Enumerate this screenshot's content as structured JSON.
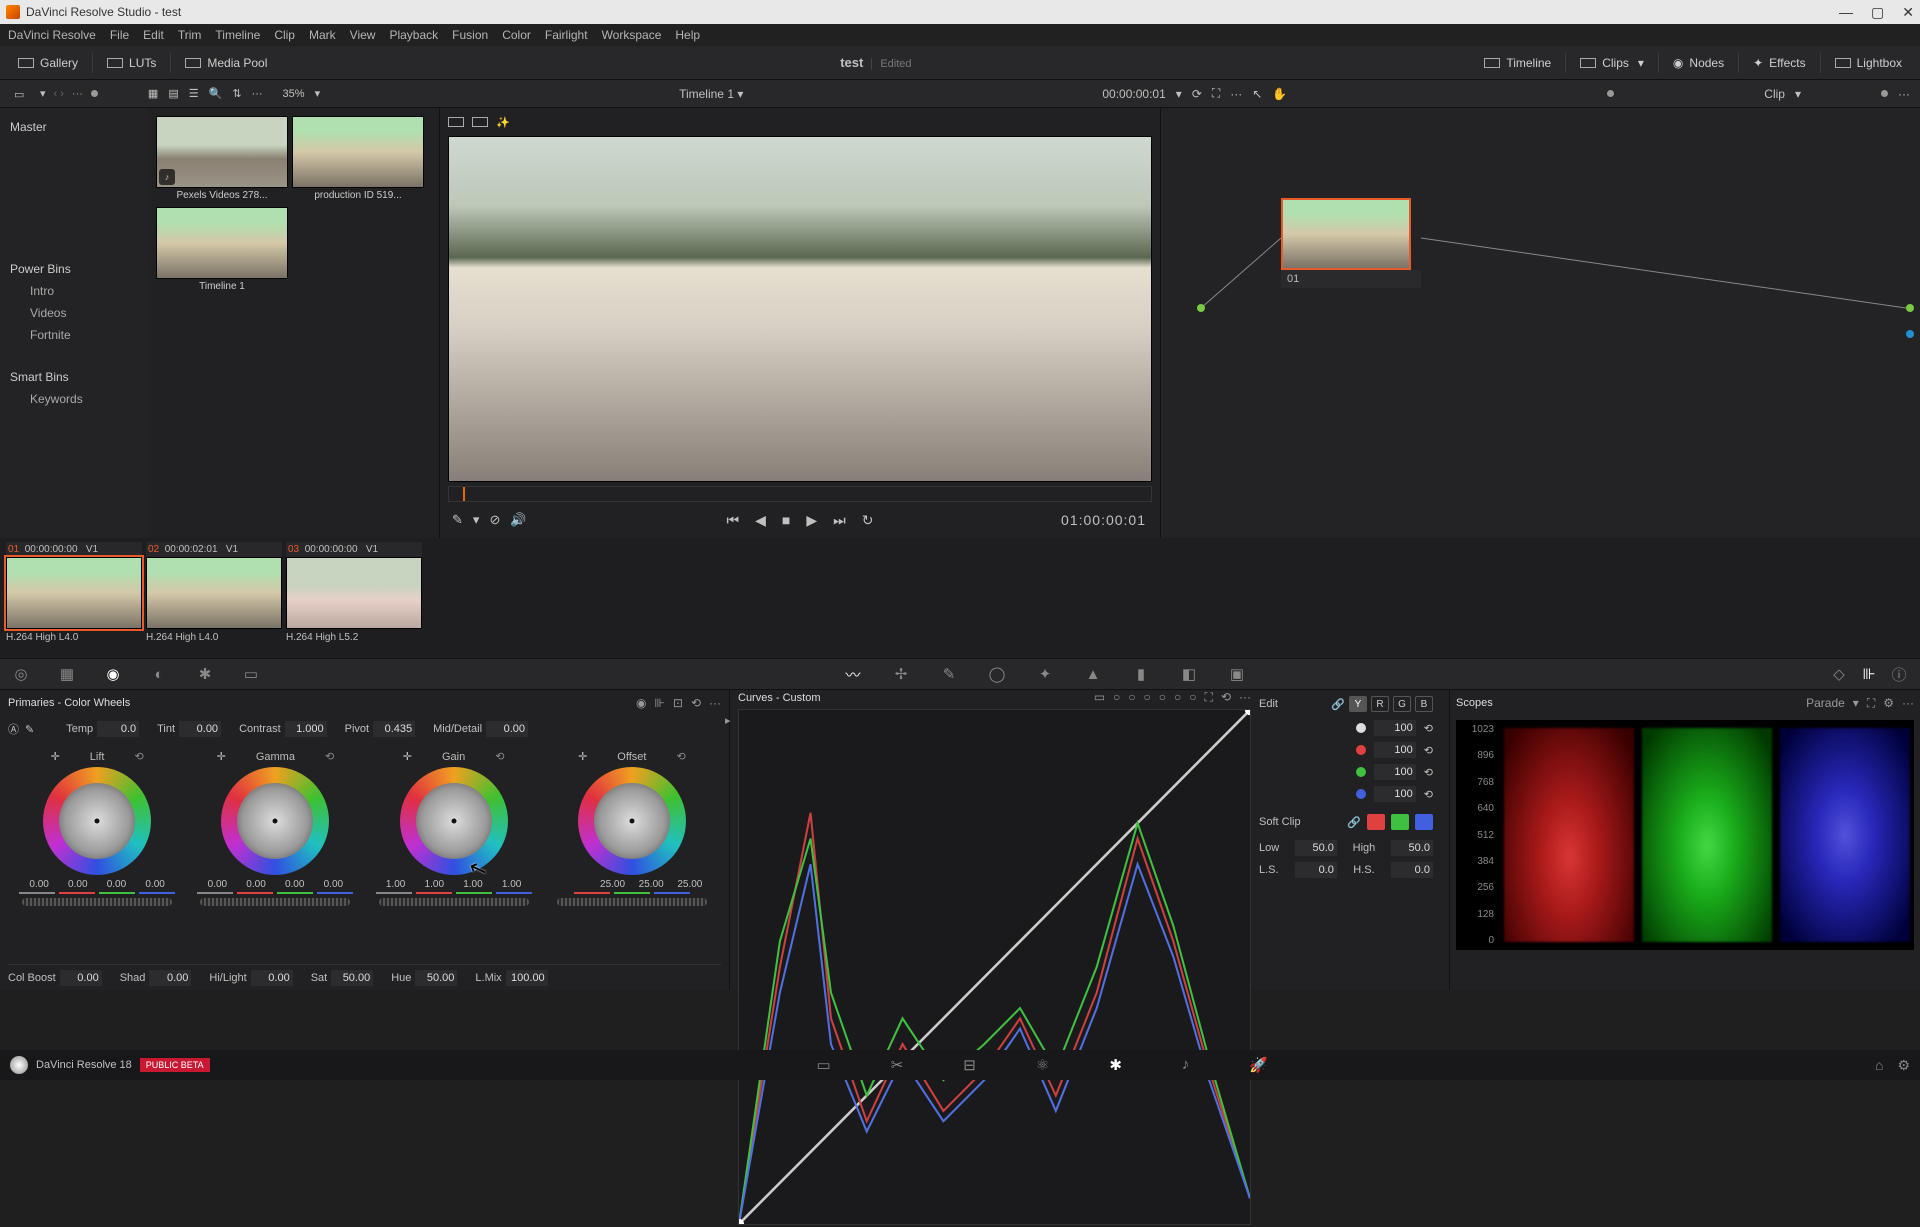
{
  "titlebar": {
    "text": "DaVinci Resolve Studio - test"
  },
  "menu": [
    "DaVinci Resolve",
    "File",
    "Edit",
    "Trim",
    "Timeline",
    "Clip",
    "Mark",
    "View",
    "Playback",
    "Fusion",
    "Color",
    "Fairlight",
    "Workspace",
    "Help"
  ],
  "toptool": {
    "gallery": "Gallery",
    "luts": "LUTs",
    "mediapool": "Media Pool",
    "title": "test",
    "edited": "Edited",
    "timeline": "Timeline",
    "clips": "Clips",
    "nodes": "Nodes",
    "effects": "Effects",
    "lightbox": "Lightbox"
  },
  "subbar": {
    "zoom": "35%",
    "timeline": "Timeline 1",
    "timecode": "00:00:00:01",
    "clip": "Clip"
  },
  "tree": {
    "master": "Master",
    "powerbins": "Power Bins",
    "powerbins_items": [
      "Intro",
      "Videos",
      "Fortnite"
    ],
    "smartbins": "Smart Bins",
    "smartbins_items": [
      "Keywords"
    ]
  },
  "thumbs": [
    {
      "label": "Pexels Videos 278..."
    },
    {
      "label": "production ID 519..."
    },
    {
      "label": "Timeline 1"
    }
  ],
  "transport": {
    "tc": "01:00:00:01"
  },
  "node": {
    "label": "01"
  },
  "clips": [
    {
      "idx": "01",
      "tc": "00:00:00:00",
      "v": "V1",
      "codec": "H.264 High L4.0"
    },
    {
      "idx": "02",
      "tc": "00:00:02:01",
      "v": "V1",
      "codec": "H.264 High L4.0"
    },
    {
      "idx": "03",
      "tc": "00:00:00:00",
      "v": "V1",
      "codec": "H.264 High L5.2"
    }
  ],
  "primaries": {
    "title": "Primaries - Color Wheels",
    "top": {
      "temp_l": "Temp",
      "temp": "0.0",
      "tint_l": "Tint",
      "tint": "0.00",
      "contrast_l": "Contrast",
      "contrast": "1.000",
      "pivot_l": "Pivot",
      "pivot": "0.435",
      "md_l": "Mid/Detail",
      "md": "0.00"
    },
    "wheels": [
      {
        "name": "Lift",
        "vals": [
          "0.00",
          "0.00",
          "0.00",
          "0.00"
        ]
      },
      {
        "name": "Gamma",
        "vals": [
          "0.00",
          "0.00",
          "0.00",
          "0.00"
        ]
      },
      {
        "name": "Gain",
        "vals": [
          "1.00",
          "1.00",
          "1.00",
          "1.00"
        ]
      },
      {
        "name": "Offset",
        "vals": [
          "25.00",
          "25.00",
          "25.00"
        ]
      }
    ],
    "bottom": {
      "colboost_l": "Col Boost",
      "colboost": "0.00",
      "shad_l": "Shad",
      "shad": "0.00",
      "hilight_l": "Hi/Light",
      "hilight": "0.00",
      "sat_l": "Sat",
      "sat": "50.00",
      "hue_l": "Hue",
      "hue": "50.00",
      "lmix_l": "L.Mix",
      "lmix": "100.00"
    }
  },
  "curves": {
    "title": "Curves - Custom",
    "edit": "Edit",
    "chips": [
      "Y",
      "R",
      "G",
      "B"
    ],
    "channels": [
      {
        "val": "100"
      },
      {
        "val": "100"
      },
      {
        "val": "100"
      },
      {
        "val": "100"
      }
    ],
    "softclip": "Soft Clip",
    "low_l": "Low",
    "low": "50.0",
    "high_l": "High",
    "high": "50.0",
    "ls_l": "L.S.",
    "ls": "0.0",
    "hs_l": "H.S.",
    "hs": "0.0"
  },
  "scopes": {
    "title": "Scopes",
    "mode": "Parade",
    "ticks": [
      "1023",
      "896",
      "768",
      "640",
      "512",
      "384",
      "256",
      "128",
      "0"
    ]
  },
  "bottom": {
    "app": "DaVinci Resolve 18",
    "beta": "PUBLIC BETA"
  }
}
